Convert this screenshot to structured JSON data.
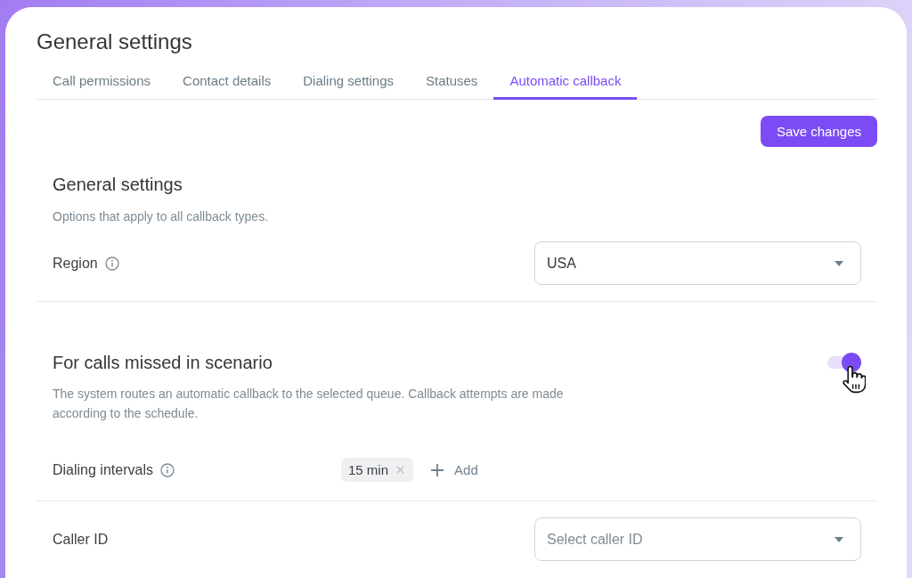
{
  "window": {
    "title": "General settings"
  },
  "tabs": [
    {
      "label": "Call permissions",
      "selected": false
    },
    {
      "label": "Contact details",
      "selected": false
    },
    {
      "label": "Dialing settings",
      "selected": false
    },
    {
      "label": "Statuses",
      "selected": false
    },
    {
      "label": "Automatic callback",
      "selected": true
    }
  ],
  "save_button": {
    "label": "Save changes"
  },
  "sections": [
    {
      "title": "General settings",
      "description": "Options that apply to all callback types.",
      "rows": [
        {
          "kind": "select",
          "label": "Region",
          "info": true,
          "value": "USA"
        }
      ]
    },
    {
      "title": "For calls missed in scenario",
      "description": "The system routes an automatic callback to the selected queue. Callback attempts are made according to the schedule.",
      "toggle": {
        "on": true
      },
      "rows": [
        {
          "kind": "chips",
          "label": "Dialing intervals",
          "info": true,
          "chips": [
            "15 min"
          ],
          "add_label": "Add"
        },
        {
          "kind": "select",
          "label": "Caller ID",
          "info": false,
          "placeholder": "Select caller ID"
        }
      ]
    }
  ]
}
